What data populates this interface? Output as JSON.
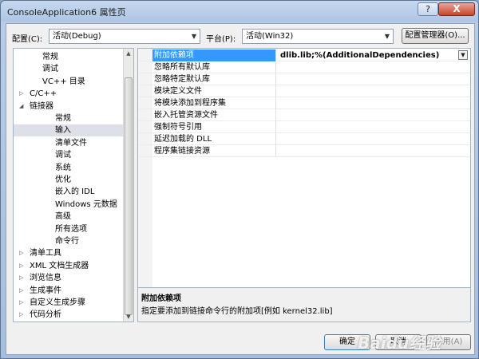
{
  "window": {
    "title": "ConsoleApplication6 属性页",
    "help_label": "?",
    "close_label": "X"
  },
  "toolbar": {
    "config_label": "配置(C):",
    "config_value": "活动(Debug)",
    "platform_label": "平台(P):",
    "platform_value": "活动(Win32)",
    "manager_button": "配置管理器(O)..."
  },
  "tree": {
    "items": [
      {
        "label": "常规",
        "level": 2
      },
      {
        "label": "调试",
        "level": 2
      },
      {
        "label": "VC++ 目录",
        "level": 2
      },
      {
        "label": "C/C++",
        "level": 1,
        "expander": "collapsed"
      },
      {
        "label": "链接器",
        "level": 1,
        "expander": "expanded"
      },
      {
        "label": "常规",
        "level": 3
      },
      {
        "label": "输入",
        "level": 3,
        "selected": true
      },
      {
        "label": "清单文件",
        "level": 3
      },
      {
        "label": "调试",
        "level": 3
      },
      {
        "label": "系统",
        "level": 3
      },
      {
        "label": "优化",
        "level": 3
      },
      {
        "label": "嵌入的 IDL",
        "level": 3
      },
      {
        "label": "Windows 元数据",
        "level": 3
      },
      {
        "label": "高级",
        "level": 3
      },
      {
        "label": "所有选项",
        "level": 3
      },
      {
        "label": "命令行",
        "level": 3
      },
      {
        "label": "清单工具",
        "level": 1,
        "expander": "collapsed"
      },
      {
        "label": "XML 文档生成器",
        "level": 1,
        "expander": "collapsed"
      },
      {
        "label": "浏览信息",
        "level": 1,
        "expander": "collapsed"
      },
      {
        "label": "生成事件",
        "level": 1,
        "expander": "collapsed"
      },
      {
        "label": "自定义生成步骤",
        "level": 1,
        "expander": "collapsed"
      },
      {
        "label": "代码分析",
        "level": 1,
        "expander": "collapsed"
      }
    ]
  },
  "properties": {
    "rows": [
      {
        "name": "附加依赖项",
        "value": "dlib.lib;%(AdditionalDependencies)",
        "selected": true
      },
      {
        "name": "忽略所有默认库",
        "value": ""
      },
      {
        "name": "忽略特定默认库",
        "value": ""
      },
      {
        "name": "模块定义文件",
        "value": ""
      },
      {
        "name": "将模块添加到程序集",
        "value": ""
      },
      {
        "name": "嵌入托管资源文件",
        "value": ""
      },
      {
        "name": "强制符号引用",
        "value": ""
      },
      {
        "name": "延迟加载的 DLL",
        "value": ""
      },
      {
        "name": "程序集链接资源",
        "value": ""
      }
    ]
  },
  "description": {
    "title": "附加依赖项",
    "text": "指定要添加到链接命令行的附加项[例如 kernel32.lib]"
  },
  "buttons": {
    "ok": "确定",
    "cancel": "取消",
    "apply": "应用(A)"
  },
  "watermark": "Baidu经验",
  "colors": {
    "selection": "#3399ff",
    "title_bar": "#b9cde6"
  }
}
